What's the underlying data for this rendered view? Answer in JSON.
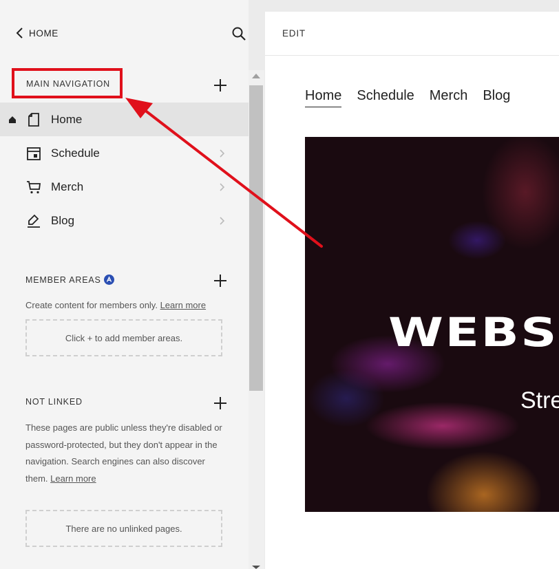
{
  "topbar": {
    "back_label": "HOME"
  },
  "main_navigation": {
    "title": "MAIN NAVIGATION",
    "items": [
      {
        "label": "Home",
        "icon": "page-icon",
        "is_homepage": true
      },
      {
        "label": "Schedule",
        "icon": "calendar-icon"
      },
      {
        "label": "Merch",
        "icon": "cart-icon"
      },
      {
        "label": "Blog",
        "icon": "blog-pen-icon"
      }
    ]
  },
  "member_areas": {
    "title": "MEMBER AREAS",
    "help_text": "Create content for members only.",
    "learn_more": "Learn more",
    "empty_text": "Click + to add member areas."
  },
  "not_linked": {
    "title": "NOT LINKED",
    "help_text": "These pages are public unless they're disabled or password-protected, but they don't appear in the navigation. Search engines can also discover them.",
    "learn_more": "Learn more",
    "empty_text": "There are no unlinked pages."
  },
  "preview": {
    "edit_label": "EDIT",
    "site_nav": [
      "Home",
      "Schedule",
      "Merch",
      "Blog"
    ],
    "hero_title": "WEBS",
    "hero_subtitle": "Stre"
  },
  "colors": {
    "highlight": "#e0101b",
    "sidebar_bg": "#f4f4f4",
    "active_item_bg": "#e3e3e3",
    "badge": "#2b4fb3"
  }
}
